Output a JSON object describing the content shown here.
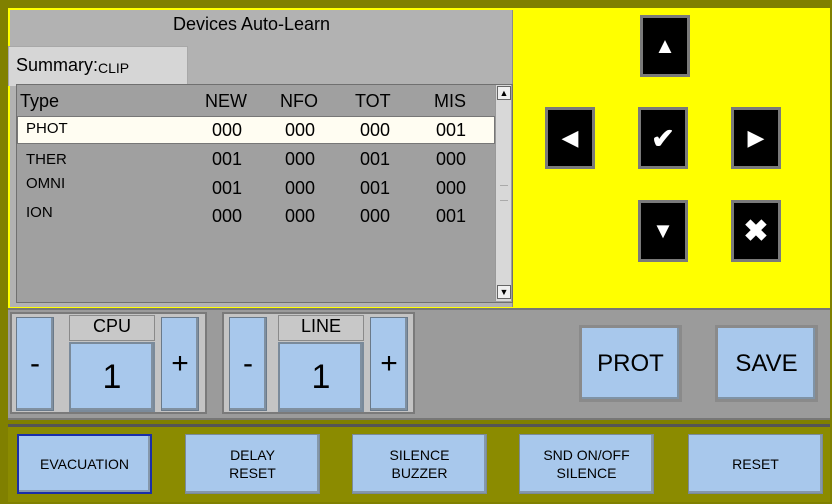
{
  "auto_learn": {
    "title": "Devices Auto-Learn",
    "summary_label": "Summary:",
    "summary_value": "CLIP",
    "columns": [
      "Type",
      "NEW",
      "NFO",
      "TOT",
      "MIS"
    ],
    "rows": [
      {
        "type": "PHOT",
        "new": "000",
        "nfo": "000",
        "tot": "000",
        "mis": "001"
      },
      {
        "type": "THER",
        "new": "001",
        "nfo": "000",
        "tot": "001",
        "mis": "000"
      },
      {
        "type": "OMNI",
        "new": "001",
        "nfo": "000",
        "tot": "001",
        "mis": "000"
      },
      {
        "type": "ION",
        "new": "000",
        "nfo": "000",
        "tot": "000",
        "mis": "001"
      }
    ],
    "selected_row": 0
  },
  "nav": {
    "up_icon": "triangle-up",
    "left_icon": "triangle-left",
    "ok_icon": "checkmark",
    "right_icon": "triangle-right",
    "down_icon": "triangle-down",
    "cancel_icon": "x-mark"
  },
  "cpu": {
    "label": "CPU",
    "value": "1",
    "minus": "-",
    "plus": "+"
  },
  "line": {
    "label": "LINE",
    "value": "1",
    "minus": "-",
    "plus": "+"
  },
  "actions": {
    "prot": "PROT",
    "save": "SAVE"
  },
  "bottom": [
    {
      "label": "EVACUATION",
      "active": true
    },
    {
      "label": "DELAY\nRESET",
      "active": false
    },
    {
      "label": "SILENCE\nBUZZER",
      "active": false
    },
    {
      "label": "SND ON/OFF\nSILENCE",
      "active": false
    },
    {
      "label": "RESET",
      "active": false
    }
  ],
  "colors": {
    "panel_yellow": "#ffff00",
    "frame_olive": "#808000",
    "button_blue": "#a8c8ec",
    "nav_black": "#000000"
  }
}
